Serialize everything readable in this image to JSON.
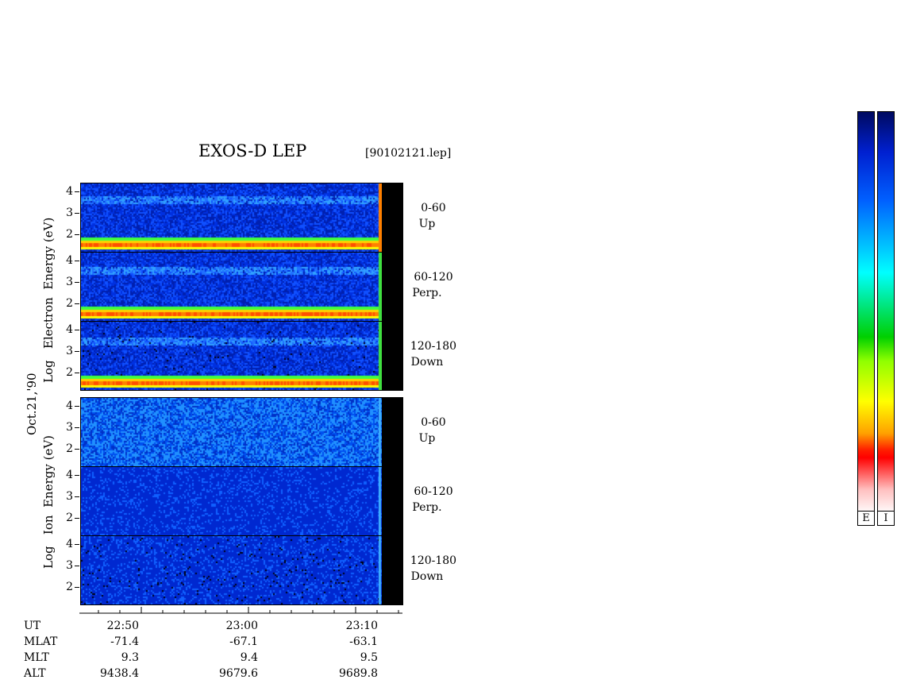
{
  "header": {
    "title": "EXOS-D LEP",
    "filename": "[90102121.lep]"
  },
  "axis": {
    "electron_label_parts": [
      "Log",
      "Electron",
      "Energy",
      "(eV)"
    ],
    "ion_label_parts": [
      "Log",
      "Ion",
      "Energy",
      "(eV)"
    ],
    "date_label": "Oct.21,'90",
    "y_ticks": [
      "4",
      "3",
      "2"
    ]
  },
  "panels": {
    "electron": [
      {
        "range": "0-60",
        "dir": "Up"
      },
      {
        "range": "60-120",
        "dir": "Perp."
      },
      {
        "range": "120-180",
        "dir": "Down"
      }
    ],
    "ion": [
      {
        "range": "0-60",
        "dir": "Up"
      },
      {
        "range": "60-120",
        "dir": "Perp."
      },
      {
        "range": "120-180",
        "dir": "Down"
      }
    ]
  },
  "colorbar": {
    "electron_label": "E",
    "ion_label": "I",
    "colors": [
      "#000a60",
      "#0020d0",
      "#0060ff",
      "#00c8ff",
      "#00ffff",
      "#00e060",
      "#00d000",
      "#90ff00",
      "#ffff00",
      "#ffa000",
      "#ff2000",
      "#ff0000",
      "#ffc0c0",
      "#ffffff"
    ]
  },
  "footer": {
    "row_labels": [
      "UT",
      "MLAT",
      "MLT",
      "ALT"
    ],
    "columns": [
      {
        "UT": "22:50",
        "MLAT": "-71.4",
        "MLT": "9.3",
        "ALT": "9438.4"
      },
      {
        "UT": "23:00",
        "MLAT": "-67.1",
        "MLT": "9.4",
        "ALT": "9679.6"
      },
      {
        "UT": "23:10",
        "MLAT": "-63.1",
        "MLT": "9.5",
        "ALT": "9689.8"
      }
    ]
  },
  "chart_data": {
    "type": "heatmap",
    "title": "EXOS-D LEP",
    "x_axis": {
      "label": "UT",
      "ticks": [
        "22:50",
        "23:00",
        "23:10"
      ]
    },
    "y_axis": {
      "label": "Log Energy (eV)",
      "ticks": [
        2,
        3,
        4
      ],
      "range": [
        1,
        4.1
      ]
    },
    "panels": [
      {
        "species": "Electron",
        "pitch_angle": "0-60",
        "dir": "Up"
      },
      {
        "species": "Electron",
        "pitch_angle": "60-120",
        "dir": "Perp."
      },
      {
        "species": "Electron",
        "pitch_angle": "120-180",
        "dir": "Down"
      },
      {
        "species": "Ion",
        "pitch_angle": "0-60",
        "dir": "Up"
      },
      {
        "species": "Ion",
        "pitch_angle": "60-120",
        "dir": "Perp."
      },
      {
        "species": "Ion",
        "pitch_angle": "120-180",
        "dir": "Down"
      }
    ]
  }
}
